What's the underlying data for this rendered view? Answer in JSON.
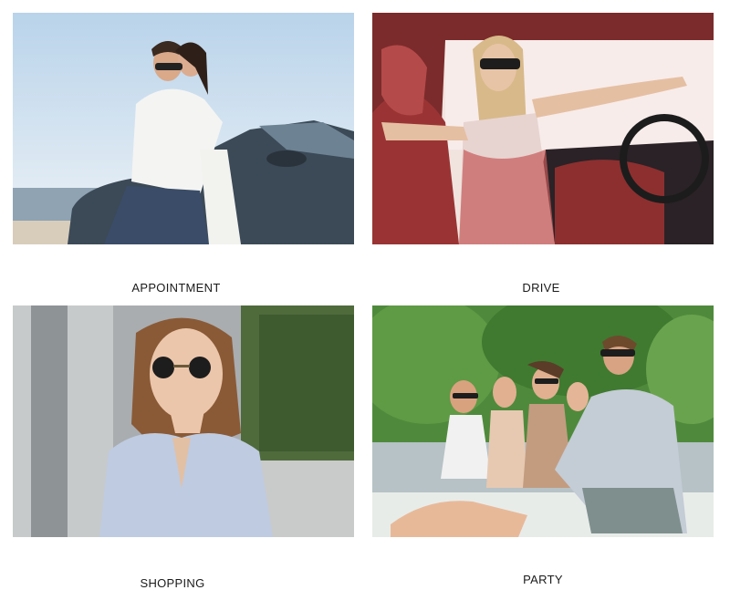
{
  "panels": [
    {
      "caption": "APPOINTMENT",
      "scene": "couple-on-convertible-beach"
    },
    {
      "caption": "DRIVE",
      "scene": "woman-driving-convertible"
    },
    {
      "caption": "SHOPPING",
      "scene": "woman-round-sunglasses-street"
    },
    {
      "caption": "PARTY",
      "scene": "friends-sitting-outdoors"
    }
  ],
  "colors": {
    "background": "#ffffff",
    "caption_text": "#1a1a1a"
  }
}
